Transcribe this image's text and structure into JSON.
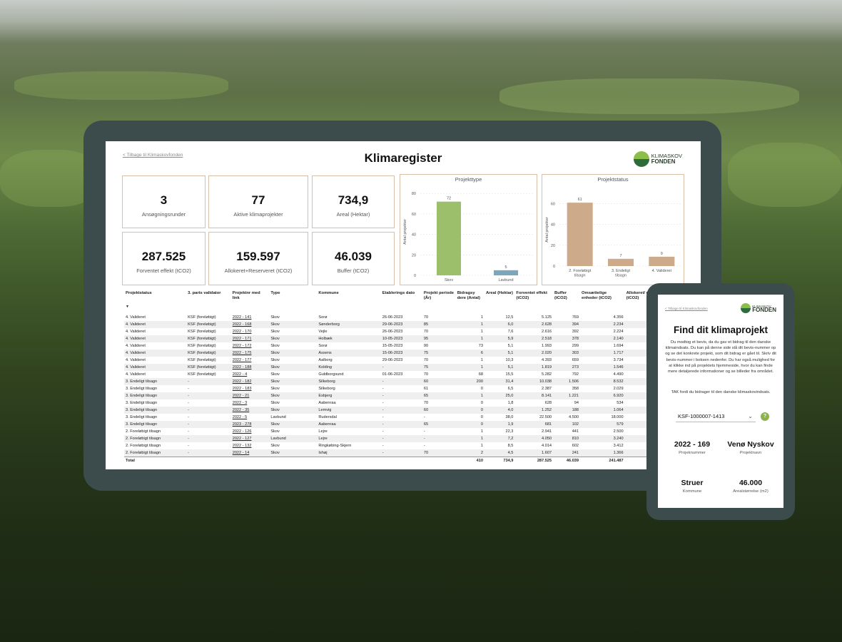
{
  "dashboard": {
    "back_link": "< Tilbage til Klimaskovfonden",
    "title": "Klimaregister",
    "logo": {
      "line1": "KLIMASKOV",
      "line2": "FONDEN"
    },
    "stats": [
      {
        "value": "3",
        "label": "Ansøgningsrunder"
      },
      {
        "value": "77",
        "label": "Aktive klimaprojekter"
      },
      {
        "value": "734,9",
        "label": "Areal (Hektar)"
      },
      {
        "value": "287.525",
        "label": "Forventet effekt (tCO2)"
      },
      {
        "value": "159.597",
        "label": "Allokeret+Reserveret (tCO2)"
      },
      {
        "value": "46.039",
        "label": "Buffer (tCO2)"
      }
    ]
  },
  "chart_data": [
    {
      "type": "bar",
      "title": "Projekttype",
      "ylabel": "Antal projekter",
      "xlabel": "",
      "ylim": [
        0,
        85
      ],
      "yticks": [
        0,
        20,
        40,
        60,
        80
      ],
      "categories": [
        "Skov",
        "Lavbund"
      ],
      "values": [
        72,
        5
      ],
      "colors": [
        "#9cbf6b",
        "#7aa7bd"
      ]
    },
    {
      "type": "bar",
      "title": "Projektstatus",
      "ylabel": "Antal projekter",
      "xlabel": "",
      "ylim": [
        0,
        70
      ],
      "yticks": [
        0,
        20,
        40,
        60
      ],
      "categories": [
        "2. Foreløbigt tilsagn",
        "3. Endeligt tilsagn",
        "4. Valideret"
      ],
      "category_lines": [
        [
          "2. Foreløbigt",
          "tilsagn"
        ],
        [
          "3. Endeligt",
          "tilsagn"
        ],
        [
          "4. Valideret"
        ]
      ],
      "values": [
        61,
        7,
        9
      ],
      "colors": [
        "#cdaa8a",
        "#cdaa8a",
        "#cdaa8a"
      ]
    }
  ],
  "table": {
    "headers": [
      "Projektstatus",
      "3. parts validator",
      "Projektnr med link",
      "Type",
      "Kommune",
      "Etablerings dato",
      "Projekt periode (År)",
      "Bidragsy dere (Antal)",
      "Areal (Hektar)",
      "Forventet effekt (tCO2)",
      "Buffer (tCO2)",
      "Omsættelige enheder (tCO2)",
      "Allokeret/ reserveret (tCO2)",
      "Ledige (tCO2)"
    ],
    "sort_indicator": "▼",
    "rows": [
      [
        "4. Valideret",
        "KSF (foreløbigt)",
        "2022 - 141",
        "Skov",
        "Sorø",
        "26-06-2023",
        "70",
        "1",
        "12,5",
        "5.125",
        "769",
        "4.356",
        "4.356",
        "0"
      ],
      [
        "4. Valideret",
        "KSF (foreløbigt)",
        "2022 - 168",
        "Skov",
        "Sønderborg",
        "29-06-2023",
        "85",
        "1",
        "6,0",
        "2.628",
        "394",
        "2.234",
        "2.234",
        "0"
      ],
      [
        "4. Valideret",
        "KSF (foreløbigt)",
        "2022 - 170",
        "Skov",
        "Vejle",
        "26-06-2023",
        "70",
        "1",
        "7,6",
        "2.616",
        "392",
        "2.224",
        "2.057",
        "167"
      ],
      [
        "4. Valideret",
        "KSF (foreløbigt)",
        "2022 - 171",
        "Skov",
        "Holbæk",
        "10-05-2023",
        "95",
        "1",
        "5,9",
        "2.518",
        "378",
        "2.140",
        "2.140",
        "0"
      ],
      [
        "4. Valideret",
        "KSF (foreløbigt)",
        "2022 - 172",
        "Skov",
        "Sorø",
        "15-05-2023",
        "90",
        "73",
        "5,1",
        "1.993",
        "299",
        "1.694",
        "1.694",
        "0"
      ],
      [
        "4. Valideret",
        "KSF (foreløbigt)",
        "2022 - 175",
        "Skov",
        "Assens",
        "15-06-2023",
        "75",
        "6",
        "5,1",
        "2.020",
        "303",
        "1.717",
        "1.717",
        "0"
      ],
      [
        "4. Valideret",
        "KSF (foreløbigt)",
        "2022 - 177",
        "Skov",
        "Aalborg",
        "29-06-2023",
        "70",
        "1",
        "10,3",
        "4.393",
        "659",
        "3.734",
        "8",
        "3.726"
      ],
      [
        "4. Valideret",
        "KSF (foreløbigt)",
        "2022 - 188",
        "Skov",
        "Kolding",
        "-",
        "75",
        "1",
        "5,1",
        "1.819",
        "273",
        "1.546",
        "1.546",
        "0"
      ],
      [
        "4. Valideret",
        "KSF (foreløbigt)",
        "2022 - 4",
        "Skov",
        "Guldborgsund",
        "01-06-2023",
        "70",
        "68",
        "15,5",
        "5.282",
        "792",
        "4.490",
        "1.170",
        "3.320"
      ],
      [
        "3. Endeligt tilsagn",
        "-",
        "2022 - 182",
        "Skov",
        "Silkeborg",
        "-",
        "60",
        "200",
        "31,4",
        "10.038",
        "1.506",
        "8.532",
        "3.568",
        "4.964"
      ],
      [
        "3. Endeligt tilsagn",
        "-",
        "2022 - 183",
        "Skov",
        "Silkeborg",
        "-",
        "61",
        "0",
        "6,5",
        "2.387",
        "358",
        "2.029",
        "0",
        "2.029"
      ],
      [
        "3. Endeligt tilsagn",
        "-",
        "2022 - 21",
        "Skov",
        "Esbjerg",
        "-",
        "65",
        "1",
        "25,0",
        "8.141",
        "1.221",
        "6.920",
        "6.920",
        "0"
      ],
      [
        "3. Endeligt tilsagn",
        "-",
        "2022 - 3",
        "Skov",
        "Aabenraa",
        "-",
        "70",
        "0",
        "1,8",
        "628",
        "94",
        "534",
        "0",
        "534"
      ],
      [
        "3. Endeligt tilsagn",
        "-",
        "2022 - 35",
        "Skov",
        "Lemvig",
        "-",
        "60",
        "0",
        "4,0",
        "1.252",
        "188",
        "1.064",
        "0",
        "1.064"
      ],
      [
        "3. Endeligt tilsagn",
        "-",
        "2022 - 5",
        "Lavbund",
        "Rudersdal",
        "-",
        "-",
        "0",
        "38,0",
        "22.500",
        "4.500",
        "18.000",
        "0",
        "18.000"
      ],
      [
        "3. Endeligt tilsagn",
        "-",
        "2023 - 278",
        "Skov",
        "Aabenraa",
        "-",
        "65",
        "0",
        "1,9",
        "681",
        "102",
        "579",
        "0",
        "579"
      ],
      [
        "2. Foreløbigt tilsagn",
        "-",
        "2022 - 126",
        "Skov",
        "Lejre",
        "-",
        "-",
        "1",
        "22,3",
        "2.941",
        "441",
        "2.500",
        "2.500",
        "0"
      ],
      [
        "2. Foreløbigt tilsagn",
        "-",
        "2022 - 127",
        "Lavbund",
        "Lejre",
        "-",
        "-",
        "1",
        "7,2",
        "4.050",
        "810",
        "3.240",
        "3.240",
        "0"
      ],
      [
        "2. Foreløbigt tilsagn",
        "-",
        "2022 - 132",
        "Skov",
        "Ringkøbing-Skjern",
        "-",
        "-",
        "1",
        "8,5",
        "4.014",
        "602",
        "3.412",
        "3.412",
        "0"
      ],
      [
        "2. Foreløbigt tilsagn",
        "-",
        "2022 - 14",
        "Skov",
        "Ishøj",
        "-",
        "70",
        "2",
        "4,5",
        "1.607",
        "241",
        "1.366",
        "1.366",
        "0"
      ]
    ],
    "total": [
      "Total",
      "",
      "",
      "",
      "",
      "",
      "",
      "410",
      "734,9",
      "287.525",
      "46.039",
      "241.487",
      "159.597",
      "81.889"
    ]
  },
  "mobile": {
    "back_link": "< Tilbage til Klimaskovfonden",
    "logo": {
      "line1": "KLIMASKOV",
      "line2": "FONDEN"
    },
    "title": "Find dit klimaprojekt",
    "description": "Du modtog et bevis, da du gav et bidrag til den danske klimaindsats. Du kan på denne side slå dit bevis-nummer op og se det konkrete projekt, som dit bidrag er gået til. Skriv dit bevis-nummer i boksen nedenfor. Du har også mulighed for at klikke ind på projektets hjemmeside, hvor du kan finde mere detaljerede informationer og se billeder fra området.",
    "thanks": "TAK fordi du bidrager til den danske klimaskovindsats.",
    "selected_id": "KSF-1000007-1413",
    "help": "?",
    "project_number": {
      "value": "2022 - 169",
      "label": "Projeknummer"
    },
    "project_name": {
      "value": "Venø Nyskov",
      "label": "Projektnavn"
    },
    "municipality": {
      "value": "Struer",
      "label": "Kommune"
    },
    "area": {
      "value": "46.000",
      "label": "Arealstørrelse (m2)"
    }
  }
}
